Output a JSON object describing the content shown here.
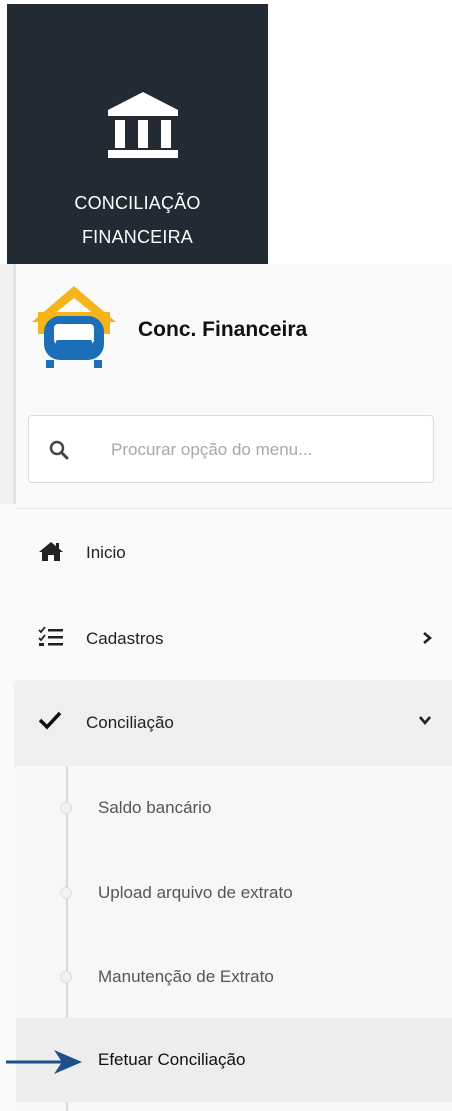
{
  "tile": {
    "label": "CONCILIAÇÃO\nFINANCEIRA",
    "icon": "bank-icon",
    "background": "#222b33"
  },
  "brand": {
    "name": "Conc. Financeira",
    "logo": "house-sofa-logo",
    "logo_colors": {
      "roof": "#f4b41a",
      "sofa": "#1b6fb8"
    }
  },
  "search": {
    "placeholder": "Procurar opção do menu..."
  },
  "menu": {
    "items": [
      {
        "label": "Inicio",
        "icon": "home-icon"
      },
      {
        "label": "Cadastros",
        "icon": "checklist-icon",
        "chevron": "chevron-right-icon"
      },
      {
        "label": "Conciliação",
        "icon": "checkmark-icon",
        "chevron": "chevron-down-icon",
        "expanded": true
      }
    ],
    "submenu": [
      {
        "label": "Saldo bancário"
      },
      {
        "label": "Upload arquivo de extrato"
      },
      {
        "label": "Manutenção de Extrato"
      },
      {
        "label": "Efetuar Conciliação",
        "active": true
      }
    ]
  },
  "annotation": {
    "icon": "arrow-right-icon",
    "color": "#1f4f8a"
  }
}
